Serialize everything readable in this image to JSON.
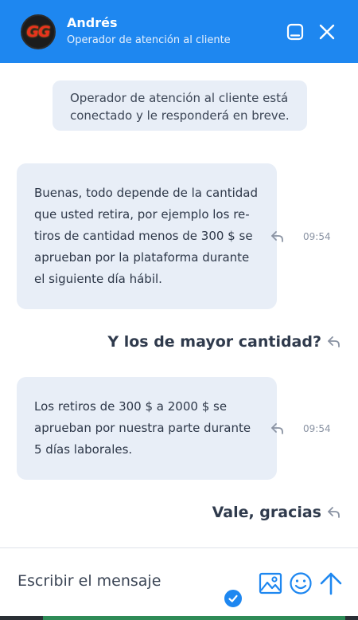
{
  "header": {
    "avatar_text": "GG",
    "agent_name": "Andrés",
    "agent_role": "Operador de atención al cliente"
  },
  "chat": {
    "system_message": "Operador de atención al cliente está conectado y le responderá en breve.",
    "messages": [
      {
        "from": "agent",
        "lines": [
          "Buenas, todo depende de la cantidad",
          "que usted retira, por ejemplo los re-",
          "tiros de cantidad menos de 300 $ se",
          "aprueban por la plataforma durante",
          "el siguiente día hábil."
        ],
        "time": "09:54"
      },
      {
        "from": "user",
        "text": "Y los de mayor cantidad?"
      },
      {
        "from": "agent",
        "lines": [
          "Los retiros de 300 $ a 2000 $ se",
          "aprueban por nuestra parte durante",
          "5 días laborales."
        ],
        "time": "09:54"
      },
      {
        "from": "user",
        "text": "Vale, gracias"
      }
    ]
  },
  "composer": {
    "placeholder": "Escribir el mensaje"
  },
  "colors": {
    "brand": "#1e87f0",
    "bubble": "#e8eef7",
    "text": "#2d3748"
  },
  "icons": {
    "minimize": "minimize-icon",
    "close": "close-icon",
    "reply": "reply-icon",
    "image": "image-icon",
    "emoji": "emoji-icon",
    "send": "arrow-up-icon",
    "verified": "check-icon"
  }
}
